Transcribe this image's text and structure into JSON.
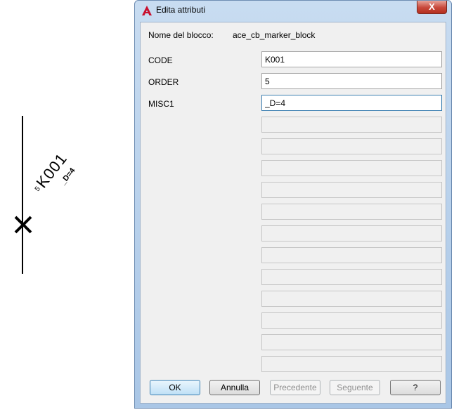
{
  "drawing": {
    "tag_order": "5",
    "tag_code": "K001",
    "tag_misc": "_D=4"
  },
  "dialog": {
    "title": "Edita attributi",
    "close_glyph": "X",
    "block_name_label": "Nome del blocco:",
    "block_name_value": "ace_cb_marker_block",
    "attributes": [
      {
        "label": "CODE",
        "value": "K001"
      },
      {
        "label": "ORDER",
        "value": "5"
      },
      {
        "label": "MISC1",
        "value": "_D=4"
      }
    ],
    "buttons": {
      "ok": "OK",
      "cancel": "Annulla",
      "previous": "Precedente",
      "next": "Seguente",
      "help": "?"
    }
  },
  "colors": {
    "title_gradient_top": "#c8dcf1",
    "close_red": "#c7473a",
    "app_icon_red": "#c8102e"
  },
  "icons": {
    "app": "autocad-logo-icon",
    "close": "close-icon",
    "marker": "cross-marker-icon"
  }
}
